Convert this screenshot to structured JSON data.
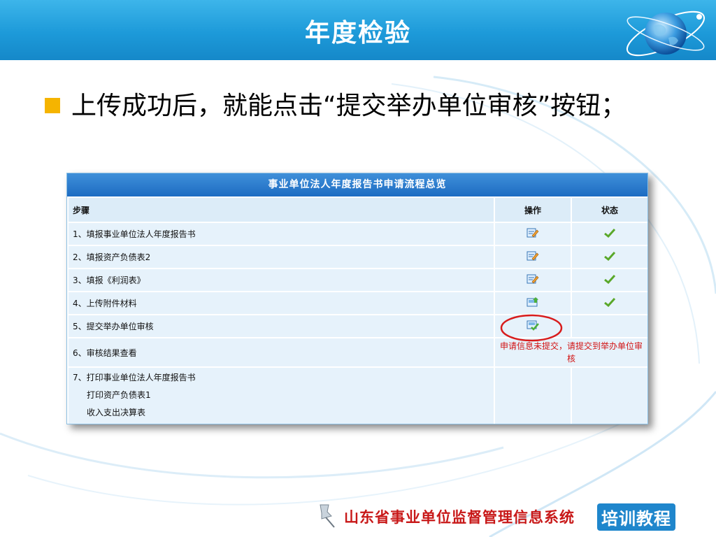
{
  "slide": {
    "title": "年度检验",
    "bullet": "上传成功后，就能点击“提交举办单位审核”按钮；",
    "footer_text": "山东省事业单位监督管理信息系统",
    "footer_badge": "培训教程"
  },
  "colors": {
    "header_blue": "#1d9ad9",
    "bullet_orange": "#f5b400",
    "table_header_blue": "#1d6cc2",
    "status_red": "#d21414",
    "check_green": "#5aa82a"
  },
  "panel": {
    "title": "事业单位法人年度报告书申请流程总览",
    "columns": [
      "步骤",
      "操作",
      "状态"
    ],
    "rows": [
      {
        "step": "1、填报事业单位法人年度报告书",
        "action_icon": "edit-form-icon",
        "status_icon": "check-icon"
      },
      {
        "step": "2、填报资产负债表2",
        "action_icon": "edit-form-icon",
        "status_icon": "check-icon"
      },
      {
        "step": "3、填报《利润表》",
        "action_icon": "edit-form-icon",
        "status_icon": "check-icon"
      },
      {
        "step": "4、上传附件材料",
        "action_icon": "upload-icon",
        "status_icon": "check-icon"
      },
      {
        "step": "5、提交举办单位审核",
        "action_icon": "submit-icon",
        "status_icon": ""
      },
      {
        "step": "6、审核结果查看",
        "action_icon": "",
        "status_text": "申请信息未提交，请提交到举办单位审核"
      },
      {
        "step": "7、打印事业单位法人年度报告书",
        "sub_items": [
          "打印资产负债表1",
          "收入支出决算表"
        ]
      }
    ]
  }
}
